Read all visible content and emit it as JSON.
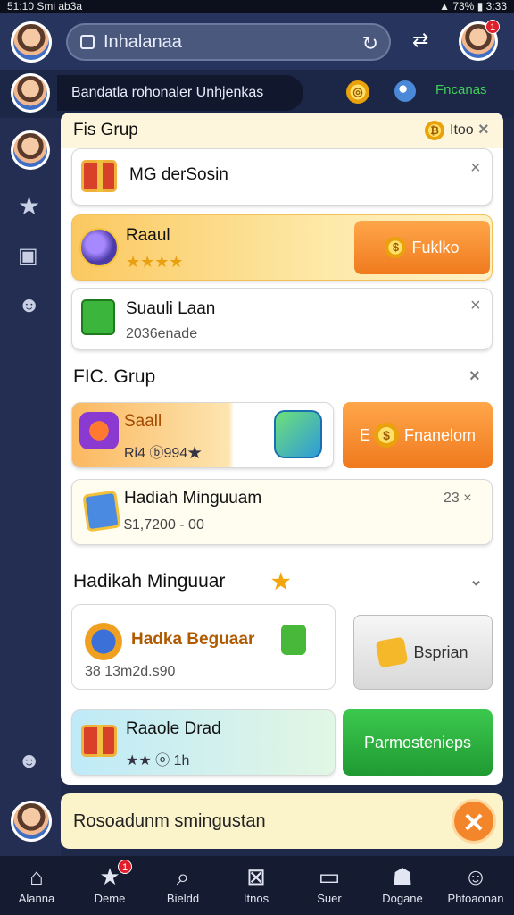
{
  "status_bar": {
    "time": "51:10",
    "carrier": "Smi ab3a",
    "battery": "73%",
    "clock_right": "3:33"
  },
  "top_bar": {
    "search_text": "Inhalanaa",
    "notification_count": "1",
    "icons": [
      "profile-avatar",
      "bag-icon",
      "refresh-icon",
      "switch-icon",
      "avatar-with-badge"
    ]
  },
  "sub_header": {
    "text": "Bandatla rohonaler Unhjenkas",
    "coin_label": "",
    "green_label": "Fncanas"
  },
  "sections": [
    {
      "heading": "Fis Grup",
      "heading_right": "Itoo",
      "items": [
        {
          "title": "MG derSosin",
          "type": "gift",
          "close": "×"
        },
        {
          "title": "Raaul",
          "sub": "★★★★",
          "button": "Fuklko",
          "type": "highlight"
        },
        {
          "title": "Suauli Laan",
          "sub": "2036enade",
          "close": "×"
        }
      ]
    },
    {
      "heading": "FIC. Grup",
      "items": [
        {
          "title": "Saall",
          "sub": "Ri4  ⓑ994★",
          "button": "Fnanelom",
          "button_prefix": "E"
        },
        {
          "title": "Hadiah Minguuam",
          "sub": "$1,7200 - 00",
          "meta": "23 ×"
        }
      ]
    },
    {
      "heading": "Hadikah Minguuar",
      "items": [
        {
          "title": "Hadka Beguaar",
          "sub": "38 13m2d.s90",
          "button": "Bsprian"
        },
        {
          "title": "Raaole Drad",
          "sub": "★★ ⓞ 1h",
          "button": "Parmostenieps"
        }
      ]
    }
  ],
  "toast": {
    "text": "Rosoadunm smingustan",
    "close": "✕"
  },
  "bottom_nav": [
    {
      "label": "Alanna",
      "icon": "home-icon"
    },
    {
      "label": "Deme",
      "icon": "star-icon",
      "badge": "1"
    },
    {
      "label": "Bieldd",
      "icon": "search-icon"
    },
    {
      "label": "Itnos",
      "icon": "grid-icon"
    },
    {
      "label": "Suer",
      "icon": "screen-icon"
    },
    {
      "label": "Dogane",
      "icon": "cap-icon"
    },
    {
      "label": "Phtoaonan",
      "icon": "profile-icon"
    }
  ],
  "colors": {
    "bg": "#1f2a4a",
    "panel": "#ffffff",
    "orange_button": "#f2852a",
    "green_button": "#25a73a",
    "toast_bg": "#fbf3c9"
  }
}
